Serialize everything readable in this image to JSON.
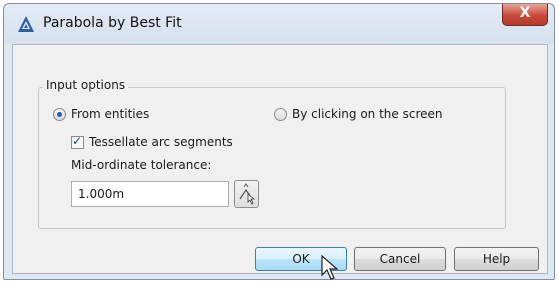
{
  "window": {
    "title": "Parabola by Best Fit",
    "close_glyph": "X"
  },
  "group": {
    "label": "Input options"
  },
  "options": {
    "from_entities": "From entities",
    "by_clicking": "By clicking on the screen",
    "selected": "from_entities"
  },
  "tessellate": {
    "label": "Tessellate arc segments",
    "checked": true
  },
  "tolerance": {
    "label": "Mid-ordinate tolerance:",
    "value": "1.000m"
  },
  "buttons": {
    "ok": "OK",
    "cancel": "Cancel",
    "help": "Help"
  },
  "icons": {
    "app": "autocad-logo-icon",
    "pick": "pick-distance-icon",
    "cursor": "mouse-pointer-icon"
  },
  "colors": {
    "close_button": "#c9493a",
    "default_button": "#3c7fb1",
    "app_icon": "#2a5fa8"
  }
}
